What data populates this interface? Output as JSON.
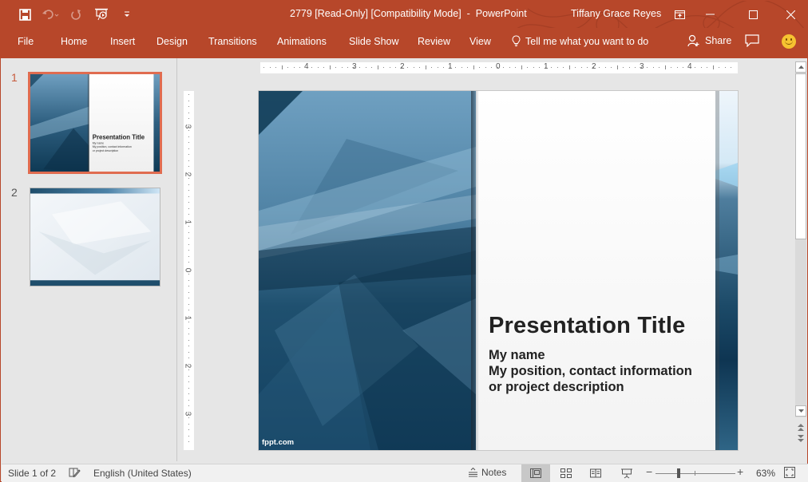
{
  "titlebar": {
    "document_title": "2779 [Read-Only] [Compatibility Mode]  -  PowerPoint",
    "user_name": "Tiffany Grace Reyes",
    "quick_access": [
      {
        "name": "save-icon",
        "enabled": true
      },
      {
        "name": "undo-icon",
        "enabled": false
      },
      {
        "name": "redo-icon",
        "enabled": false
      },
      {
        "name": "start-from-beginning-icon",
        "enabled": true
      },
      {
        "name": "customize-qat-icon",
        "enabled": true
      }
    ],
    "window_buttons": [
      "ribbon-display-options-icon",
      "minimize-icon",
      "maximize-icon",
      "close-icon"
    ]
  },
  "ribbon": {
    "tabs": [
      "File",
      "Home",
      "Insert",
      "Design",
      "Transitions",
      "Animations",
      "Slide Show",
      "Review",
      "View"
    ],
    "tell_me": "Tell me what you want to do",
    "share": "Share",
    "accent_color": "#b7472a"
  },
  "thumbnails": [
    {
      "number": "1",
      "selected": true,
      "title": "Presentation Title"
    },
    {
      "number": "2",
      "selected": false,
      "title": ""
    }
  ],
  "rulers": {
    "horizontal": [
      "4",
      "3",
      "2",
      "1",
      "0",
      "1",
      "2",
      "3",
      "4"
    ],
    "vertical": [
      "3",
      "2",
      "1",
      "0",
      "1",
      "2",
      "3"
    ]
  },
  "slide": {
    "title": "Presentation Title",
    "subtitle_lines": [
      "My name",
      "My position, contact information",
      "or project description"
    ],
    "watermark": "fppt.com"
  },
  "statusbar": {
    "slide_indicator": "Slide 1 of 2",
    "language": "English (United States)",
    "notes_label": "Notes",
    "views": [
      "normal-view",
      "slide-sorter-view",
      "reading-view",
      "slideshow-view"
    ],
    "active_view": "normal-view",
    "zoom_percent": "63%",
    "zoom_value": 63
  }
}
